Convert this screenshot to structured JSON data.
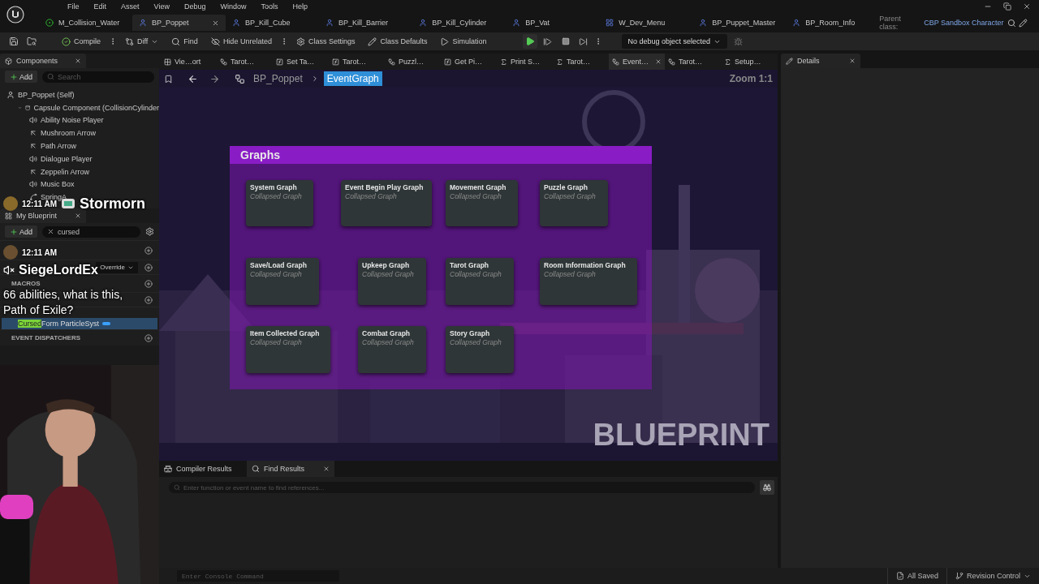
{
  "menu": [
    "File",
    "Edit",
    "Asset",
    "View",
    "Debug",
    "Window",
    "Tools",
    "Help"
  ],
  "document_tabs": [
    {
      "label": "M_Collision_Water",
      "kind": "material",
      "selected": false
    },
    {
      "label": "BP_Poppet",
      "kind": "blueprint",
      "selected": true
    },
    {
      "label": "BP_Kill_Cube",
      "kind": "blueprint",
      "selected": false
    },
    {
      "label": "BP_Kill_Barrier",
      "kind": "blueprint",
      "selected": false
    },
    {
      "label": "BP_Kill_Cylinder",
      "kind": "blueprint",
      "selected": false
    },
    {
      "label": "BP_Vat",
      "kind": "blueprint",
      "selected": false
    },
    {
      "label": "W_Dev_Menu",
      "kind": "widget",
      "selected": false
    },
    {
      "label": "BP_Puppet_Master",
      "kind": "blueprint",
      "selected": false
    },
    {
      "label": "BP_Room_Info",
      "kind": "blueprint",
      "selected": false
    }
  ],
  "parent_class": {
    "label": "Parent class:",
    "value": "CBP Sandbox Character"
  },
  "toolbar": {
    "buttons": [
      {
        "label": "Compile",
        "kind": "compile"
      },
      {
        "label": "Diff",
        "kind": "diff"
      },
      {
        "label": "Find",
        "kind": "find"
      },
      {
        "label": "Hide Unrelated",
        "kind": "hide"
      },
      {
        "label": "Class Settings",
        "kind": "settings"
      },
      {
        "label": "Class Defaults",
        "kind": "defaults"
      },
      {
        "label": "Simulation",
        "kind": "simulation"
      }
    ],
    "debug_select": "No debug object selected"
  },
  "components_panel": {
    "title": "Components",
    "add": "Add",
    "search_placeholder": "Search",
    "tree": [
      {
        "label": "BP_Poppet (Self)",
        "kind": "self",
        "children": [
          {
            "label": "Capsule Component (CollisionCylinder",
            "kind": "capsule",
            "expanded": true,
            "children": [
              {
                "label": "Ability Noise Player",
                "kind": "sound"
              },
              {
                "label": "Mushroom Arrow",
                "kind": "arrow"
              },
              {
                "label": "Path Arrow",
                "kind": "arrow"
              },
              {
                "label": "Dialogue Player",
                "kind": "sound"
              },
              {
                "label": "Zeppelin Arrow",
                "kind": "arrow"
              },
              {
                "label": "Music Box",
                "kind": "sound"
              },
              {
                "label": "SpringA",
                "kind": "spring"
              }
            ]
          }
        ]
      }
    ]
  },
  "my_blueprint": {
    "title": "My Blueprint",
    "add": "Add",
    "search_value": "cursed",
    "override": "Override",
    "macros": "MACROS",
    "match_row": {
      "match": "Cursed",
      "rest": " Form ParticleSyst"
    },
    "event_dispatchers": "EVENT DISPATCHERS"
  },
  "graph_tabs": [
    {
      "label": "Vie…ort",
      "kind": "viewport",
      "selected": false
    },
    {
      "label": "Tarot…",
      "kind": "graph",
      "selected": false
    },
    {
      "label": "Set Ta…",
      "kind": "function",
      "selected": false
    },
    {
      "label": "Tarot…",
      "kind": "function",
      "selected": false
    },
    {
      "label": "Puzzl…",
      "kind": "graph",
      "selected": false
    },
    {
      "label": "Get Pi…",
      "kind": "function",
      "selected": false
    },
    {
      "label": "Print S…",
      "kind": "macro",
      "selected": false
    },
    {
      "label": "Tarot…",
      "kind": "macro",
      "selected": false
    },
    {
      "label": "Event…",
      "kind": "graph",
      "selected": true
    },
    {
      "label": "Tarot…",
      "kind": "graph",
      "selected": false
    },
    {
      "label": "Setup…",
      "kind": "macro",
      "selected": false
    }
  ],
  "breadcrumb": [
    {
      "label": "BP_Poppet",
      "selected": false
    },
    {
      "label": "EventGraph",
      "selected": true
    }
  ],
  "zoom": "Zoom 1:1",
  "comment": {
    "title": "Graphs",
    "nodes": [
      {
        "title": "System Graph",
        "subtitle": "Collapsed Graph"
      },
      {
        "title": "Event Begin Play Graph",
        "subtitle": "Collapsed Graph"
      },
      {
        "title": "Movement Graph",
        "subtitle": "Collapsed Graph"
      },
      {
        "title": "Puzzle Graph",
        "subtitle": "Collapsed Graph"
      },
      {
        "title": "Save/Load Graph",
        "subtitle": "Collapsed Graph"
      },
      {
        "title": "Upkeep Graph",
        "subtitle": "Collapsed Graph"
      },
      {
        "title": "Tarot Graph",
        "subtitle": "Collapsed Graph"
      },
      {
        "title": "Room Information Graph",
        "subtitle": "Collapsed Graph"
      },
      {
        "title": "Item Collected Graph",
        "subtitle": "Collapsed Graph"
      },
      {
        "title": "Combat Graph",
        "subtitle": "Collapsed Graph"
      },
      {
        "title": "Story Graph",
        "subtitle": "Collapsed Graph"
      }
    ]
  },
  "graph_label": "BLUEPRINT",
  "details_tab": "Details",
  "bottom_tabs": [
    {
      "label": "Compiler Results",
      "kind": "compiler",
      "selected": false
    },
    {
      "label": "Find Results",
      "kind": "find",
      "selected": true
    }
  ],
  "find_placeholder": "Enter function or event name to find references...",
  "console_placeholder": "Enter Console Command",
  "status": {
    "saved": "All Saved",
    "revision": "Revision Control"
  },
  "chat": [
    {
      "time": "12:11 AM",
      "user": "Stormorn"
    },
    {
      "time": "12:11 AM",
      "user": "SiegeLordEx",
      "muted": true,
      "message": "66 abilities, what is this, Path of Exile?"
    }
  ]
}
